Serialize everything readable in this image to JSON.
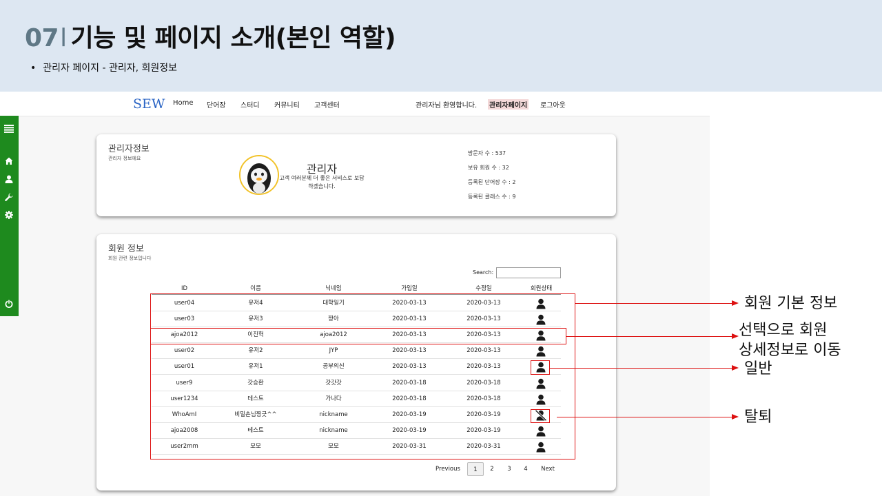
{
  "slide": {
    "number": "07",
    "separator": "l",
    "title": "기능 및 페이지 소개(본인 역할)",
    "bullet_mark": "•",
    "bullet": "관리자 페이지 - 관리자, 회원정보"
  },
  "nav": {
    "logo": "SEW",
    "items": [
      "Home",
      "단어장",
      "스터디",
      "커뮤니티",
      "고객센터"
    ],
    "welcome": "관리자님 환영합니다.",
    "admin_page": "관리자페이지",
    "logout": "로그아웃"
  },
  "sidebar": {
    "icons": [
      "menu-icon",
      "home-icon",
      "user-icon",
      "wrench-icon",
      "gear-icon",
      "power-icon"
    ]
  },
  "admin_card": {
    "title": "관리자정보",
    "subtitle": "관리자 정보에요",
    "name": "관리자",
    "description": "고객 여러분께 더 좋은 서비스로 보답하겠습니다.",
    "stats": [
      "방문자 수 : 537",
      "보유 회원 수 : 32",
      "등록된 단어장 수 : 2",
      "등록된 클래스 수 : 9"
    ]
  },
  "member_card": {
    "title": "회원 정보",
    "subtitle": "회원 관련 정보입니다",
    "search_label": "Search:",
    "search_value": "",
    "columns": [
      "ID",
      "이름",
      "닉네임",
      "가입일",
      "수정일",
      "회원상태"
    ],
    "rows": [
      {
        "id": "user04",
        "name": "유저4",
        "nick": "대학일기",
        "joined": "2020-03-13",
        "modified": "2020-03-13",
        "status": "active"
      },
      {
        "id": "user03",
        "name": "유저3",
        "nick": "짱아",
        "joined": "2020-03-13",
        "modified": "2020-03-13",
        "status": "active"
      },
      {
        "id": "ajoa2012",
        "name": "이진혁",
        "nick": "ajoa2012",
        "joined": "2020-03-13",
        "modified": "2020-03-13",
        "status": "active"
      },
      {
        "id": "user02",
        "name": "유저2",
        "nick": "JYP",
        "joined": "2020-03-13",
        "modified": "2020-03-13",
        "status": "active"
      },
      {
        "id": "user01",
        "name": "유저1",
        "nick": "공부의신",
        "joined": "2020-03-13",
        "modified": "2020-03-13",
        "status": "active"
      },
      {
        "id": "user9",
        "name": "갓승환",
        "nick": "갓갓갓",
        "joined": "2020-03-18",
        "modified": "2020-03-18",
        "status": "active"
      },
      {
        "id": "user1234",
        "name": "테스트",
        "nick": "가나다",
        "joined": "2020-03-18",
        "modified": "2020-03-18",
        "status": "active"
      },
      {
        "id": "WhoAmI",
        "name": "비밀손님찡긋^^",
        "nick": "nickname",
        "joined": "2020-03-19",
        "modified": "2020-03-19",
        "status": "withdrawn"
      },
      {
        "id": "ajoa2008",
        "name": "테스트",
        "nick": "nickname",
        "joined": "2020-03-19",
        "modified": "2020-03-19",
        "status": "active"
      },
      {
        "id": "user2mm",
        "name": "모모",
        "nick": "모모",
        "joined": "2020-03-31",
        "modified": "2020-03-31",
        "status": "active"
      }
    ],
    "pagination": {
      "previous": "Previous",
      "pages": [
        "1",
        "2",
        "3",
        "4"
      ],
      "current": "1",
      "next": "Next"
    }
  },
  "annotations": {
    "basic_info": "회원 기본 정보",
    "select_detail_line1": "선택으로 회원",
    "select_detail_line2": "상세정보로 이동",
    "normal": "일반",
    "withdrawn": "탈퇴"
  },
  "colors": {
    "header_bg": "#dde7f2",
    "number_color": "#5f7886",
    "logo": "#2a64c4",
    "sidebar": "#1e8a1e",
    "annotation_red": "#dd1111",
    "admin_highlight": "#f4d9d9"
  }
}
